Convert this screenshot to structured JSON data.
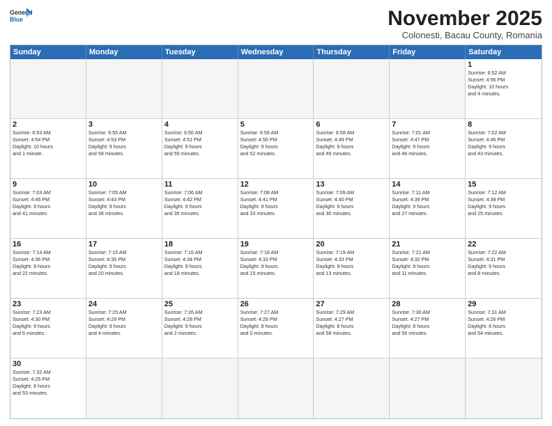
{
  "header": {
    "logo_general": "General",
    "logo_blue": "Blue",
    "month": "November 2025",
    "location": "Colonesti, Bacau County, Romania"
  },
  "day_headers": [
    "Sunday",
    "Monday",
    "Tuesday",
    "Wednesday",
    "Thursday",
    "Friday",
    "Saturday"
  ],
  "cells": [
    {
      "date": "",
      "info": "",
      "empty": true
    },
    {
      "date": "",
      "info": "",
      "empty": true
    },
    {
      "date": "",
      "info": "",
      "empty": true
    },
    {
      "date": "",
      "info": "",
      "empty": true
    },
    {
      "date": "",
      "info": "",
      "empty": true
    },
    {
      "date": "",
      "info": "",
      "empty": true
    },
    {
      "date": "1",
      "info": "Sunrise: 6:52 AM\nSunset: 4:56 PM\nDaylight: 10 hours\nand 4 minutes.",
      "empty": false
    },
    {
      "date": "2",
      "info": "Sunrise: 6:53 AM\nSunset: 4:54 PM\nDaylight: 10 hours\nand 1 minute.",
      "empty": false
    },
    {
      "date": "3",
      "info": "Sunrise: 6:55 AM\nSunset: 4:53 PM\nDaylight: 9 hours\nand 58 minutes.",
      "empty": false
    },
    {
      "date": "4",
      "info": "Sunrise: 6:56 AM\nSunset: 4:51 PM\nDaylight: 9 hours\nand 55 minutes.",
      "empty": false
    },
    {
      "date": "5",
      "info": "Sunrise: 6:58 AM\nSunset: 4:50 PM\nDaylight: 9 hours\nand 52 minutes.",
      "empty": false
    },
    {
      "date": "6",
      "info": "Sunrise: 6:59 AM\nSunset: 4:49 PM\nDaylight: 9 hours\nand 49 minutes.",
      "empty": false
    },
    {
      "date": "7",
      "info": "Sunrise: 7:01 AM\nSunset: 4:47 PM\nDaylight: 9 hours\nand 46 minutes.",
      "empty": false
    },
    {
      "date": "8",
      "info": "Sunrise: 7:02 AM\nSunset: 4:46 PM\nDaylight: 9 hours\nand 43 minutes.",
      "empty": false
    },
    {
      "date": "9",
      "info": "Sunrise: 7:03 AM\nSunset: 4:45 PM\nDaylight: 9 hours\nand 41 minutes.",
      "empty": false
    },
    {
      "date": "10",
      "info": "Sunrise: 7:05 AM\nSunset: 4:43 PM\nDaylight: 9 hours\nand 38 minutes.",
      "empty": false
    },
    {
      "date": "11",
      "info": "Sunrise: 7:06 AM\nSunset: 4:42 PM\nDaylight: 9 hours\nand 35 minutes.",
      "empty": false
    },
    {
      "date": "12",
      "info": "Sunrise: 7:08 AM\nSunset: 4:41 PM\nDaylight: 9 hours\nand 33 minutes.",
      "empty": false
    },
    {
      "date": "13",
      "info": "Sunrise: 7:09 AM\nSunset: 4:40 PM\nDaylight: 9 hours\nand 30 minutes.",
      "empty": false
    },
    {
      "date": "14",
      "info": "Sunrise: 7:11 AM\nSunset: 4:39 PM\nDaylight: 9 hours\nand 27 minutes.",
      "empty": false
    },
    {
      "date": "15",
      "info": "Sunrise: 7:12 AM\nSunset: 4:38 PM\nDaylight: 9 hours\nand 25 minutes.",
      "empty": false
    },
    {
      "date": "16",
      "info": "Sunrise: 7:14 AM\nSunset: 4:36 PM\nDaylight: 9 hours\nand 22 minutes.",
      "empty": false
    },
    {
      "date": "17",
      "info": "Sunrise: 7:15 AM\nSunset: 4:35 PM\nDaylight: 9 hours\nand 20 minutes.",
      "empty": false
    },
    {
      "date": "18",
      "info": "Sunrise: 7:16 AM\nSunset: 4:34 PM\nDaylight: 9 hours\nand 18 minutes.",
      "empty": false
    },
    {
      "date": "19",
      "info": "Sunrise: 7:18 AM\nSunset: 4:33 PM\nDaylight: 9 hours\nand 15 minutes.",
      "empty": false
    },
    {
      "date": "20",
      "info": "Sunrise: 7:19 AM\nSunset: 4:33 PM\nDaylight: 9 hours\nand 13 minutes.",
      "empty": false
    },
    {
      "date": "21",
      "info": "Sunrise: 7:21 AM\nSunset: 4:32 PM\nDaylight: 9 hours\nand 11 minutes.",
      "empty": false
    },
    {
      "date": "22",
      "info": "Sunrise: 7:22 AM\nSunset: 4:31 PM\nDaylight: 9 hours\nand 8 minutes.",
      "empty": false
    },
    {
      "date": "23",
      "info": "Sunrise: 7:23 AM\nSunset: 4:30 PM\nDaylight: 9 hours\nand 6 minutes.",
      "empty": false
    },
    {
      "date": "24",
      "info": "Sunrise: 7:25 AM\nSunset: 4:29 PM\nDaylight: 9 hours\nand 4 minutes.",
      "empty": false
    },
    {
      "date": "25",
      "info": "Sunrise: 7:26 AM\nSunset: 4:28 PM\nDaylight: 9 hours\nand 2 minutes.",
      "empty": false
    },
    {
      "date": "26",
      "info": "Sunrise: 7:27 AM\nSunset: 4:28 PM\nDaylight: 9 hours\nand 0 minutes.",
      "empty": false
    },
    {
      "date": "27",
      "info": "Sunrise: 7:29 AM\nSunset: 4:27 PM\nDaylight: 8 hours\nand 58 minutes.",
      "empty": false
    },
    {
      "date": "28",
      "info": "Sunrise: 7:30 AM\nSunset: 4:27 PM\nDaylight: 8 hours\nand 56 minutes.",
      "empty": false
    },
    {
      "date": "29",
      "info": "Sunrise: 7:31 AM\nSunset: 4:26 PM\nDaylight: 8 hours\nand 54 minutes.",
      "empty": false
    },
    {
      "date": "30",
      "info": "Sunrise: 7:32 AM\nSunset: 4:25 PM\nDaylight: 8 hours\nand 53 minutes.",
      "empty": false
    },
    {
      "date": "",
      "info": "",
      "empty": true
    },
    {
      "date": "",
      "info": "",
      "empty": true
    },
    {
      "date": "",
      "info": "",
      "empty": true
    },
    {
      "date": "",
      "info": "",
      "empty": true
    },
    {
      "date": "",
      "info": "",
      "empty": true
    },
    {
      "date": "",
      "info": "",
      "empty": true
    }
  ]
}
